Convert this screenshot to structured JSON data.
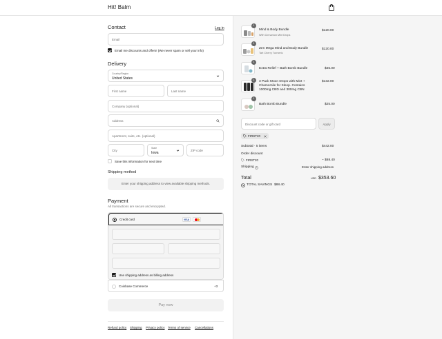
{
  "header": {
    "brand": "Hit! Balm",
    "cart_icon": "shopping-bag-icon"
  },
  "contact": {
    "title": "Contact",
    "login_link": "Log in",
    "email_placeholder": "Email",
    "marketing_label": "Email me discounts and offers! (We never spam or sell your info)",
    "marketing_checked": true
  },
  "delivery": {
    "title": "Delivery",
    "country_label": "Country/Region",
    "country_value": "United States",
    "first_name_placeholder": "First name",
    "last_name_placeholder": "Last name",
    "company_placeholder": "Company (optional)",
    "address_placeholder": "Address",
    "apartment_placeholder": "Apartment, suite, etc. (optional)",
    "city_placeholder": "City",
    "state_label": "State",
    "state_value": "Iowa",
    "zip_placeholder": "ZIP code",
    "save_info_label": "Save this information for next time",
    "save_info_checked": false
  },
  "shipping": {
    "title": "Shipping method",
    "notice": "Enter your shipping address to view available shipping methods."
  },
  "payment": {
    "title": "Payment",
    "subtitle": "All transactions are secure and encrypted.",
    "credit_card_label": "Credit card",
    "visa_label": "VISA",
    "use_shipping_label": "Use shipping address as billing address",
    "use_shipping_checked": true,
    "coinbase_label": "Coinbase Commerce",
    "coinbase_more": "+3",
    "pay_button": "Pay now"
  },
  "footer": {
    "links": [
      "Refund policy",
      "Shipping",
      "Privacy policy",
      "Terms of service",
      "Cancellations"
    ]
  },
  "summary": {
    "items": [
      {
        "name": "Mind & Body Bundle",
        "variant": "With Cinnamon Mint Drops",
        "price": "$120.00",
        "quantity": "1"
      },
      {
        "name": "Zen Mega Mind and Body Bundle",
        "variant": "Tart Cherry Turmeric",
        "price": "$120.00",
        "quantity": "1"
      },
      {
        "name": "Extra Relief + Bath Bomb Bundle",
        "variant": "",
        "price": "$45.00",
        "quantity": "1"
      },
      {
        "name": "3 Pack Moon Drops with Mint + Chamomile for Sleep. Contains 1000mg CBD and 300mg CBN",
        "variant": "",
        "price": "$132.00",
        "quantity": "1"
      },
      {
        "name": "Bath Bomb Bundle",
        "variant": "",
        "price": "$25.00",
        "quantity": "1"
      }
    ],
    "discount_placeholder": "Discount code or gift card",
    "apply_label": "Apply",
    "applied_code": "FIRST20",
    "subtotal_label": "Subtotal · 5 items",
    "subtotal_value": "$442.00",
    "order_discount_label": "Order discount",
    "order_discount_code": "FIRST20",
    "order_discount_value": "− $88.40",
    "shipping_label": "Shipping",
    "shipping_value": "Enter shipping address",
    "total_label": "Total",
    "currency": "USD",
    "total_value": "$353.60",
    "savings_label": "TOTAL SAVINGS",
    "savings_value": "$88.40"
  }
}
